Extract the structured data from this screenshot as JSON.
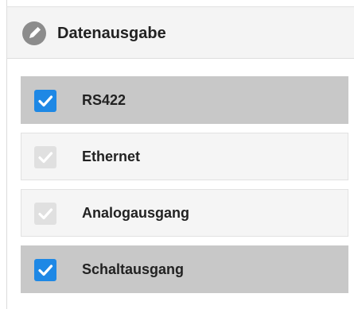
{
  "header": {
    "title": "Datenausgabe",
    "icon": "pencil-icon"
  },
  "colors": {
    "checkbox_checked": "#1e88e5",
    "checkbox_unchecked": "#e0e0e0",
    "row_checked_bg": "#c8c8c8",
    "row_unchecked_bg": "#f5f5f5",
    "header_bg": "#f4f4f4"
  },
  "options": [
    {
      "label": "RS422",
      "checked": true
    },
    {
      "label": "Ethernet",
      "checked": false
    },
    {
      "label": "Analogausgang",
      "checked": false
    },
    {
      "label": "Schaltausgang",
      "checked": true
    }
  ]
}
